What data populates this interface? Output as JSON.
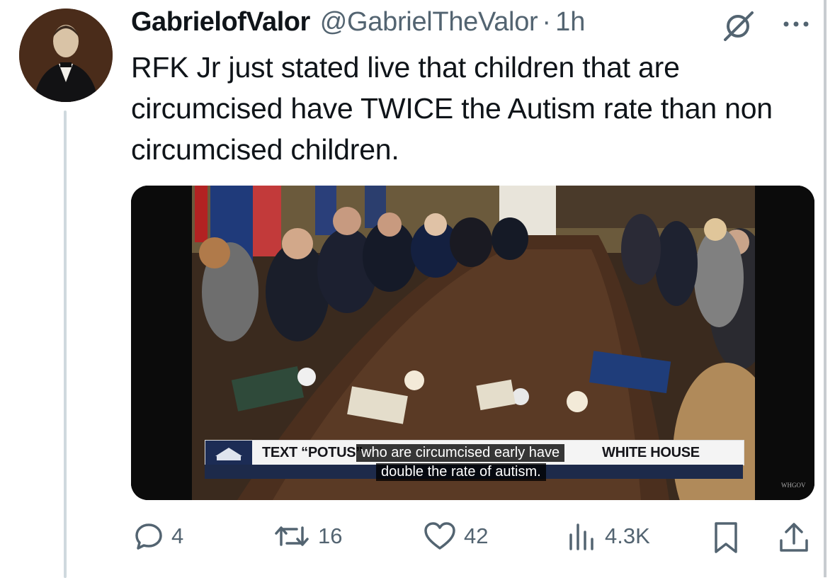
{
  "tweet": {
    "display_name": "GabrielofValor",
    "handle": "@GabrielTheValor",
    "separator": "·",
    "time": "1h",
    "text": "RFK Jr just stated live that children that are circumcised have TWICE the Autism rate than non circumcised children."
  },
  "media": {
    "ticker_left": "TEXT “POTUS” ",
    "ticker_right": "WHITE HOUSE",
    "subtitle_line1": "who are circumcised early have",
    "subtitle_line2": "double the rate of autism.",
    "watermark": "WHGOV"
  },
  "actions": {
    "replies": "4",
    "reposts": "16",
    "likes": "42",
    "views": "4.3K"
  },
  "icons": {
    "reply": "reply-icon",
    "repost": "repost-icon",
    "like": "heart-icon",
    "views": "views-icon",
    "bookmark": "bookmark-icon",
    "share": "share-icon",
    "grok": "grok-icon",
    "more": "more-icon"
  },
  "colors": {
    "text": "#0f1419",
    "secondary": "#536471",
    "thread_line": "#cfd9de"
  }
}
